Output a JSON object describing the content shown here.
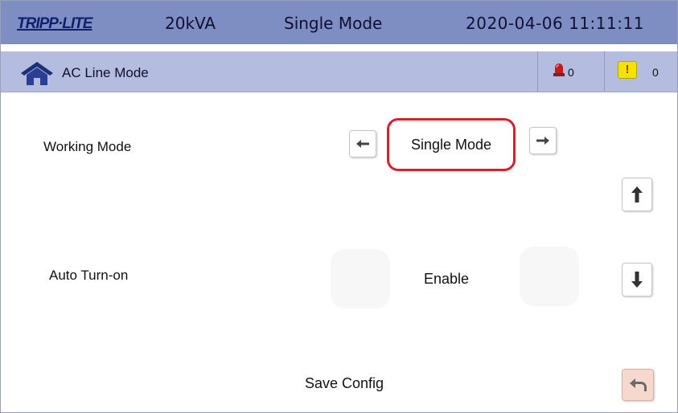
{
  "header": {
    "brand": "TRIPP·LITE",
    "capacity": "20kVA",
    "mode": "Single Mode",
    "datetime": "2020-04-06 11:11:11"
  },
  "statusbar": {
    "mode_label": "AC Line Mode",
    "alarm_count": "0",
    "warning_count": "0",
    "warning_symbol": "!"
  },
  "settings": {
    "working_mode_label": "Working Mode",
    "working_mode_value": "Single Mode",
    "auto_turn_on_label": "Auto Turn-on",
    "auto_turn_on_value": "Enable",
    "save_config_label": "Save Config"
  },
  "icons": {
    "home": "home-icon",
    "alarm": "alarm-light-icon",
    "warning": "warning-icon",
    "prev": "arrow-left-icon",
    "next": "arrow-right-icon",
    "up": "arrow-up-icon",
    "down": "arrow-down-icon",
    "back": "return-icon"
  },
  "colors": {
    "topbar": "#7e8ec3",
    "statusbar": "#b4bde0",
    "highlight": "#d6202f",
    "warning": "#f3e300",
    "back_button": "#f6d8cc"
  }
}
